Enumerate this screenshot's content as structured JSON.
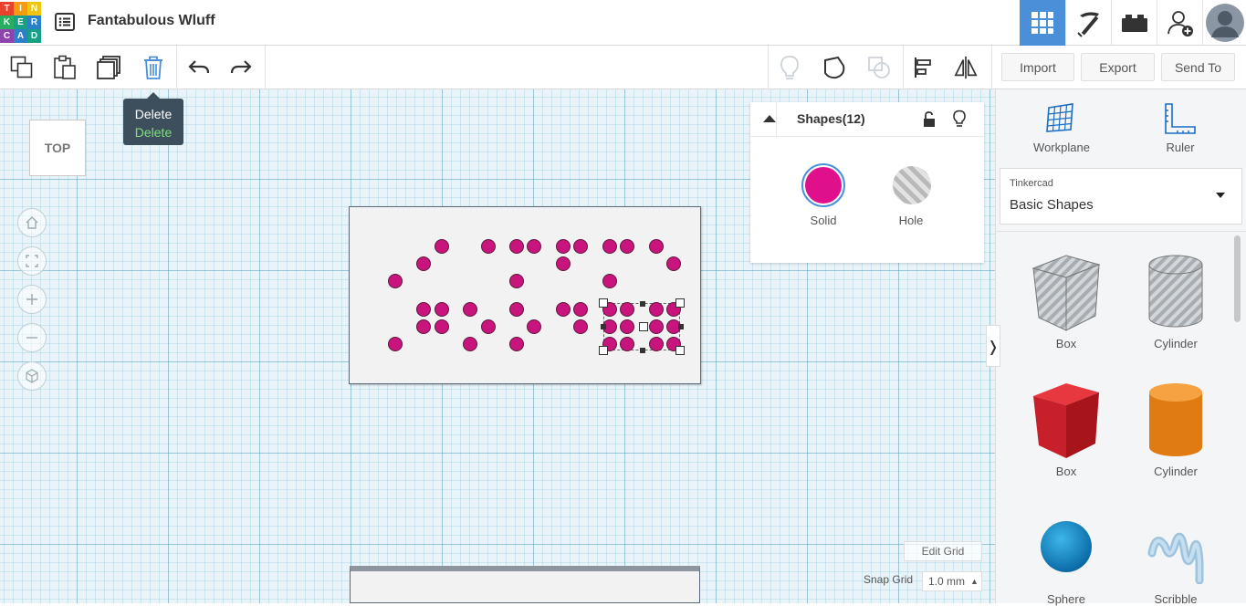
{
  "app": {
    "logo_letters": [
      "T",
      "I",
      "N",
      "K",
      "E",
      "R",
      "C",
      "A",
      "D"
    ],
    "logo_colors": [
      "#e8412c",
      "#f39c12",
      "#f1c40f",
      "#27ae60",
      "#16a085",
      "#2c80c5",
      "#8e44ad",
      "#2c80c5",
      "#16a085"
    ],
    "document_title": "Fantabulous Wluff"
  },
  "header": {
    "icons": [
      "grid-view-icon",
      "pickaxe-icon",
      "brick-icon",
      "add-user-icon",
      "avatar"
    ]
  },
  "toolbar": {
    "tooltip_title": "Delete",
    "tooltip_shortcut": "Delete",
    "import_label": "Import",
    "export_label": "Export",
    "send_to_label": "Send To"
  },
  "canvas": {
    "view_label": "TOP",
    "edit_grid_label": "Edit Grid",
    "snap_grid_label": "Snap Grid",
    "snap_grid_value": "1.0 mm"
  },
  "inspector": {
    "title": "Shapes(12)",
    "solid_label": "Solid",
    "hole_label": "Hole",
    "solid_color": "#e0108c"
  },
  "right_panel": {
    "workplane_label": "Workplane",
    "ruler_label": "Ruler",
    "library_category": "Tinkercad",
    "library_name": "Basic Shapes",
    "shapes": [
      {
        "label": "Box"
      },
      {
        "label": "Cylinder"
      },
      {
        "label": "Box"
      },
      {
        "label": "Cylinder"
      },
      {
        "label": "Sphere"
      },
      {
        "label": "Scribble"
      }
    ]
  },
  "colors": {
    "accent": "#4a90d9",
    "tooltip_bg": "#3d4f5c",
    "dot_fill": "#c9137d"
  }
}
